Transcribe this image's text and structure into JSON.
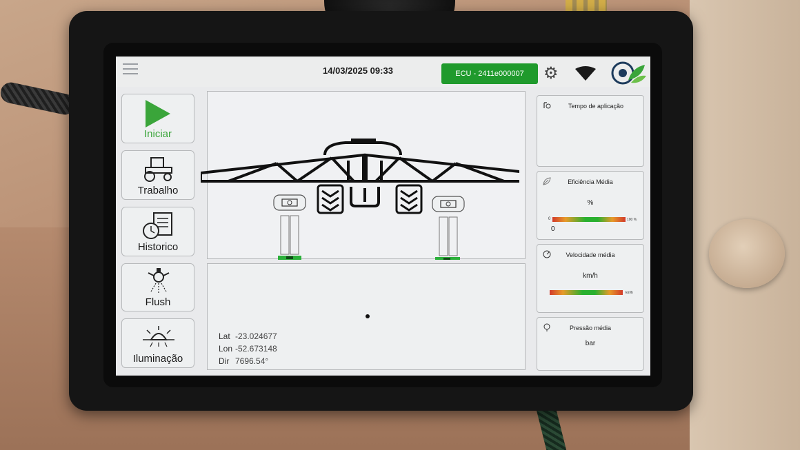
{
  "topbar": {
    "datetime": "14/03/2025 09:33",
    "ecu_label": "ECU - 2411e000007",
    "icons": [
      "menu-icon",
      "gear-icon",
      "wifi-icon",
      "app-logo"
    ]
  },
  "nav": [
    {
      "label": "Iniciar",
      "icon": "play-icon"
    },
    {
      "label": "Trabalho",
      "icon": "tractor-icon"
    },
    {
      "label": "Historico",
      "icon": "document-clock-icon"
    },
    {
      "label": "Flush",
      "icon": "nozzle-spray-icon"
    },
    {
      "label": "Iluminação",
      "icon": "light-icon"
    }
  ],
  "gps": {
    "lat_label": "Lat",
    "lat_value": "-23.024677",
    "lon_label": "Lon",
    "lon_value": "-52.673148",
    "dir_label": "Dir",
    "dir_value": "7696.54°"
  },
  "stats": {
    "tempo": {
      "title": "Tempo de aplicação",
      "icon": "timer-icon"
    },
    "eficiencia": {
      "title": "Eficiência Média",
      "unit": "%",
      "gauge_min": "0",
      "gauge_max": "100 %",
      "value": "0",
      "icon": "leaf-icon"
    },
    "velocidade": {
      "title": "Velocidade média",
      "unit": "km/h",
      "gauge_max": "km/h",
      "icon": "speedometer-icon"
    },
    "pressao": {
      "title": "Pressão média",
      "unit": "bar",
      "icon": "pressure-icon"
    }
  },
  "colors": {
    "ecu_green": "#1f9a2c",
    "play_green": "#3aa53a",
    "section_green": "#2bb03a"
  }
}
